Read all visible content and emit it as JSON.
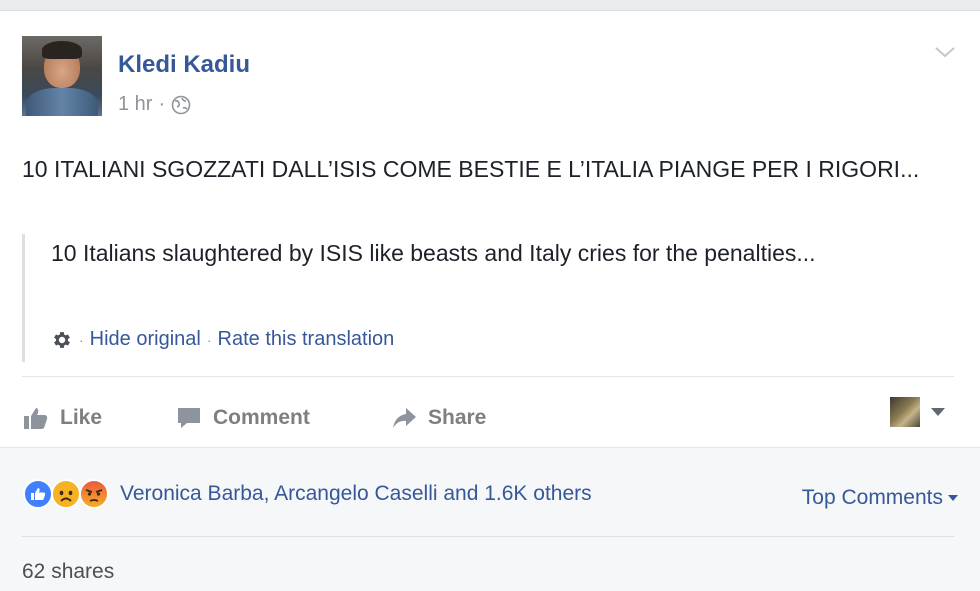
{
  "post": {
    "author": "Kledi Kadiu",
    "time": "1 hr",
    "meta_separator": "·",
    "text": "10 ITALIANI SGOZZATI DALL’ISIS COME BESTIE E L’ITALIA PIANGE PER I RIGORI...",
    "translation": {
      "text": "10 Italians slaughtered by ISIS like beasts and Italy cries for the penalties...",
      "hide_original": "Hide original",
      "rate_translation": "Rate this translation",
      "separator": "·"
    },
    "audience_icon": "globe-icon"
  },
  "actions": {
    "like": "Like",
    "comment": "Comment",
    "share": "Share"
  },
  "footer": {
    "reaction_icons": [
      "like-reaction-icon",
      "sad-reaction-icon",
      "angry-reaction-icon"
    ],
    "reactors": "Veronica Barba, Arcangelo Caselli and 1.6K others",
    "sort_label": "Top Comments",
    "shares": "62 shares"
  },
  "colors": {
    "link": "#365899",
    "muted": "#90949c",
    "like_blue": "#3b5998",
    "angry_red": "#e9573f",
    "sad_yellow": "#f7b125"
  }
}
